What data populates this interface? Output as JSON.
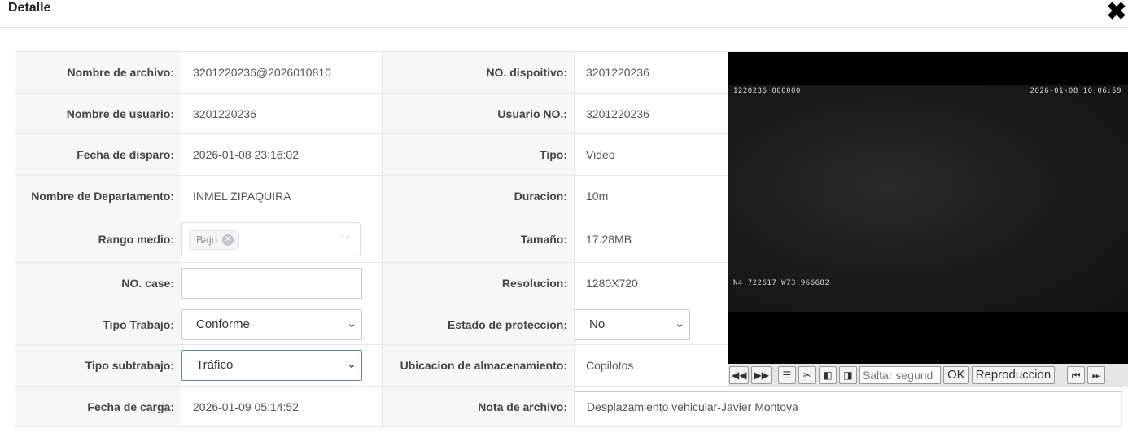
{
  "header": {
    "title": "Detalle"
  },
  "fields": {
    "file_name": {
      "label": "Nombre de archivo:",
      "value": "3201220236@2026010810"
    },
    "device_no": {
      "label": "NO. dispoitivo:",
      "value": "3201220236"
    },
    "user_name": {
      "label": "Nombre de usuario:",
      "value": "3201220236"
    },
    "user_no": {
      "label": "Usuario NO.:",
      "value": "3201220236"
    },
    "trigger_date": {
      "label": "Fecha de disparo:",
      "value": "2026-01-08 23:16:02"
    },
    "type": {
      "label": "Tipo:",
      "value": "Video"
    },
    "department": {
      "label": "Nombre de Departamento:",
      "value": "INMEL ZIPAQUIRA"
    },
    "duration": {
      "label": "Duracion:",
      "value": "10m"
    },
    "range": {
      "label": "Rango medio:",
      "tag": "Bajo"
    },
    "size": {
      "label": "Tamaño:",
      "value": "17.28MB"
    },
    "case_no": {
      "label": "NO. case:",
      "value": ""
    },
    "resolution": {
      "label": "Resolucion:",
      "value": "1280X720"
    },
    "work_type": {
      "label": "Tipo Trabajo:",
      "value": "Conforme"
    },
    "protection": {
      "label": "Estado de proteccion:",
      "value": "No"
    },
    "subwork_type": {
      "label": "Tipo subtrabajo:",
      "value": "Tráfico"
    },
    "storage": {
      "label": "Ubicacion de almacenamiento:",
      "value": "Copilotos"
    },
    "upload_date": {
      "label": "Fecha de carga:",
      "value": "2026-01-09 05:14:52"
    },
    "file_note": {
      "label": "Nota de archivo:",
      "value": "Desplazamiento vehicular-Javier Montoya"
    }
  },
  "video": {
    "osd_id": "1220236_000000",
    "osd_time": "2026-01-08 10:06:59",
    "osd_gps": "N4.722617  W73.966682"
  },
  "controls": {
    "rewind": "◀◀",
    "forward": "▶▶",
    "list": "☰",
    "cut": "✂",
    "prev_frame": "◧",
    "next_frame": "◨",
    "jump_placeholder": "Saltar segund",
    "ok": "OK",
    "playback": "Reproduccion",
    "first": "⏮",
    "last": "⏭"
  }
}
